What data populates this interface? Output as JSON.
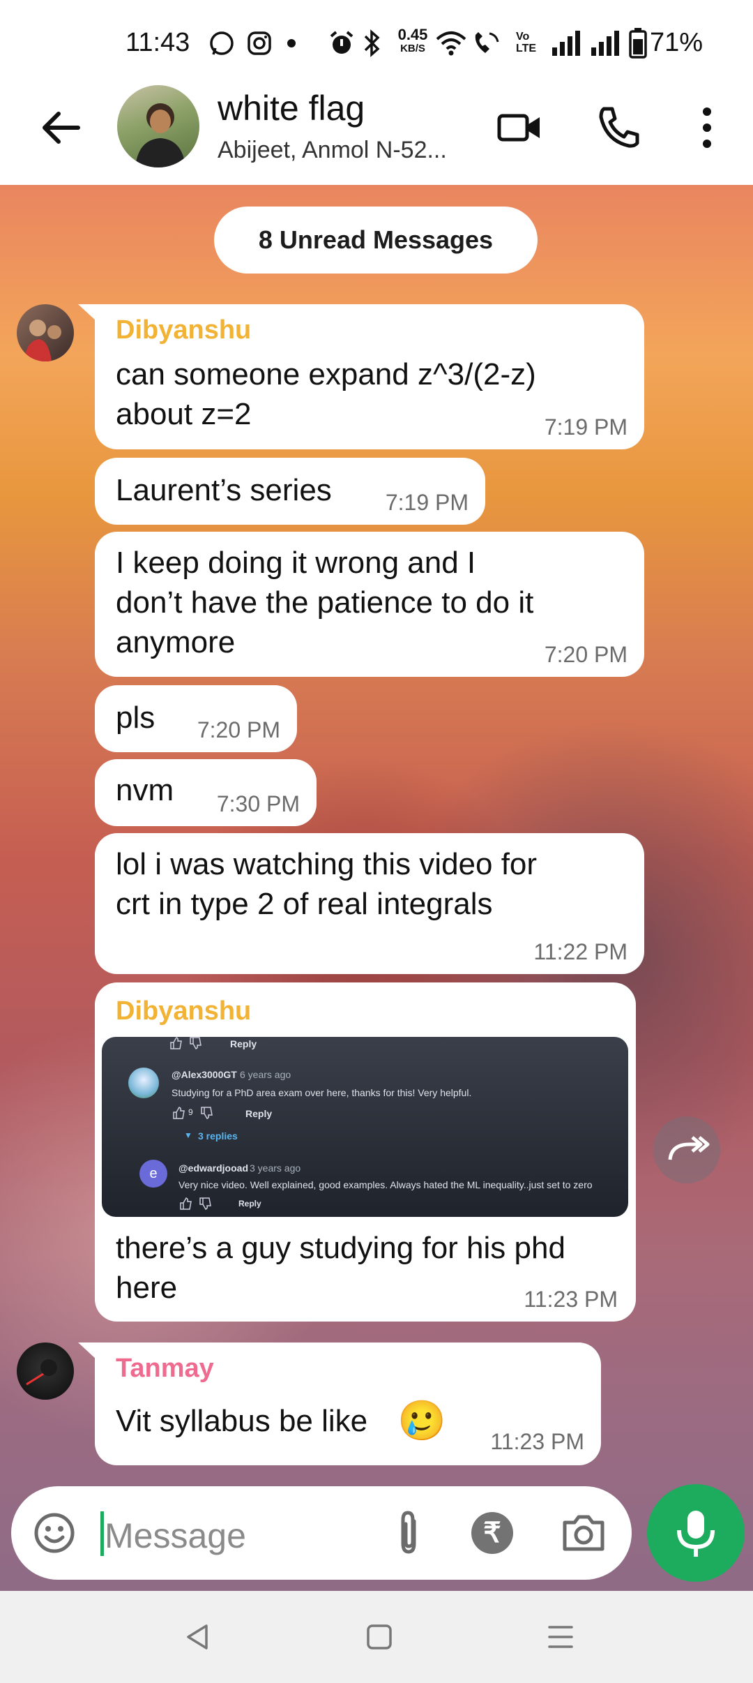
{
  "status_bar": {
    "time": "11:43",
    "net_speed_value": "0.45",
    "net_speed_unit": "KB/S",
    "volte": "Vo LTE",
    "battery": "71%"
  },
  "header": {
    "group_name": "white flag",
    "members": "Abijeet, Anmol N-52..."
  },
  "unread_label": "8 Unread Messages",
  "messages": [
    {
      "sender": "Dibyanshu",
      "text_lines": [
        "can someone expand z^3/(2-z)",
        "about z=2"
      ],
      "time": "7:19 PM"
    },
    {
      "text": "Laurent’s series",
      "time": "7:19 PM"
    },
    {
      "text_lines": [
        "I keep doing it wrong and I",
        "don’t have the patience to do it",
        "anymore"
      ],
      "time": "7:20 PM"
    },
    {
      "text": "pls",
      "time": "7:20 PM"
    },
    {
      "text": "nvm",
      "time": "7:30 PM"
    },
    {
      "text_lines": [
        "lol i was watching this video for",
        "crt in type 2 of real integrals"
      ],
      "time": "11:22 PM"
    },
    {
      "sender": "Dibyanshu",
      "image": {
        "reply_1": "Reply",
        "user_1": "@Alex3000GT",
        "age_1": "6 years ago",
        "comment_1": "Studying for a PhD area exam over here, thanks for this!  Very helpful.",
        "likes_1": "9",
        "reply_2": "Reply",
        "replies_link": "3 replies",
        "avatar_letter": "e",
        "user_2": "@edwardjooad",
        "age_2": "3 years ago",
        "comment_2": "Very nice video. Well explained, good examples. Always hated the ML inequality..just set to zero",
        "reply_3": "Reply"
      },
      "text_lines": [
        "there’s a guy studying for his phd",
        "here"
      ],
      "time": "11:23 PM"
    },
    {
      "sender": "Tanmay",
      "text": "Vit syllabus be like",
      "emoji": "🥲",
      "time": "11:23 PM"
    }
  ],
  "input": {
    "placeholder": "Message",
    "currency_symbol": "₹"
  },
  "colors": {
    "sender_dibyanshu": "#f2b233",
    "sender_tanmay": "#ef6a8f",
    "mic_button": "#1dab5e",
    "cursor": "#1dab5e"
  },
  "icons": {
    "back": "arrow-left-icon",
    "video": "video-camera-icon",
    "call": "phone-icon",
    "menu": "more-vertical-icon",
    "emoji": "emoji-icon",
    "attach": "paperclip-icon",
    "payment": "rupee-icon",
    "camera": "camera-icon",
    "mic": "mic-icon",
    "forward": "forward-icon"
  }
}
